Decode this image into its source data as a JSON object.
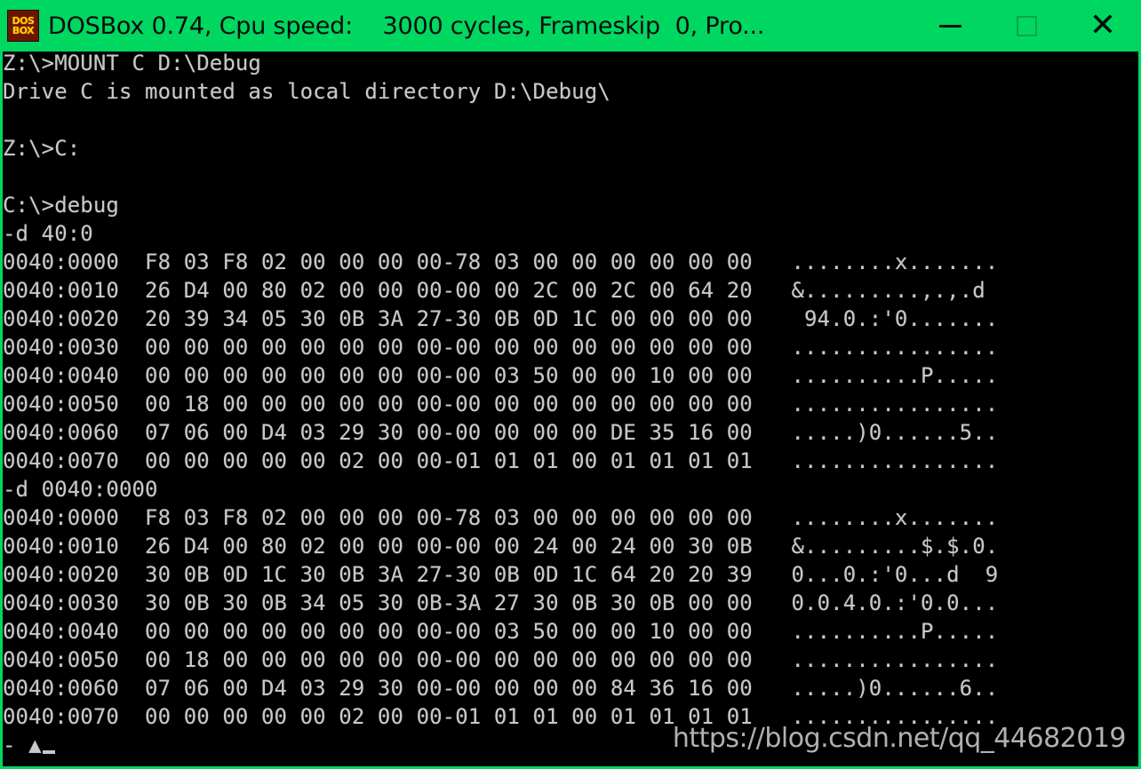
{
  "window": {
    "title": "DOSBox 0.74, Cpu speed:    3000 cycles, Frameskip  0, Pro...",
    "icon_line1": "DOS",
    "icon_line2": "BOX",
    "titlebar_color": "#00d760",
    "title_text_color": "#0b0b0b",
    "controls": {
      "minimize_label": "—",
      "maximize_label": "□",
      "close_label": "✕"
    }
  },
  "terminal": {
    "background": "#000000",
    "foreground": "#c8c8c8",
    "lines": [
      "Z:\\>MOUNT C D:\\Debug",
      "Drive C is mounted as local directory D:\\Debug\\",
      "",
      "Z:\\>C:",
      "",
      "C:\\>debug",
      "-d 40:0",
      "0040:0000  F8 03 F8 02 00 00 00 00-78 03 00 00 00 00 00 00   ........x.......",
      "0040:0010  26 D4 00 80 02 00 00 00-00 00 2C 00 2C 00 64 20   &.........,.,.d ",
      "0040:0020  20 39 34 05 30 0B 3A 27-30 0B 0D 1C 00 00 00 00    94.0.:'0.......",
      "0040:0030  00 00 00 00 00 00 00 00-00 00 00 00 00 00 00 00   ................",
      "0040:0040  00 00 00 00 00 00 00 00-00 03 50 00 00 10 00 00   ..........P.....",
      "0040:0050  00 18 00 00 00 00 00 00-00 00 00 00 00 00 00 00   ................",
      "0040:0060  07 06 00 D4 03 29 30 00-00 00 00 00 DE 35 16 00   .....)0......5..",
      "0040:0070  00 00 00 00 00 02 00 00-01 01 01 00 01 01 01 01   ................",
      "-d 0040:0000",
      "0040:0000  F8 03 F8 02 00 00 00 00-78 03 00 00 00 00 00 00   ........x.......",
      "0040:0010  26 D4 00 80 02 00 00 00-00 00 24 00 24 00 30 0B   &.........$.$.0.",
      "0040:0020  30 0B 0D 1C 30 0B 3A 27-30 0B 0D 1C 64 20 20 39   0...0.:'0...d  9",
      "0040:0030  30 0B 30 0B 34 05 30 0B-3A 27 30 0B 30 0B 00 00   0.0.4.0.:'0.0...",
      "0040:0040  00 00 00 00 00 00 00 00-00 03 50 00 00 10 00 00   ..........P.....",
      "0040:0050  00 18 00 00 00 00 00 00-00 00 00 00 00 00 00 00   ................",
      "0040:0060  07 06 00 D4 03 29 30 00-00 00 00 00 84 36 16 00   .....)0......6..",
      "0040:0070  00 00 00 00 00 02 00 00-01 01 01 00 01 01 01 01   ................"
    ],
    "prompt_line": "- ▲"
  },
  "watermark": {
    "text": "https://blog.csdn.net/qq_44682019"
  }
}
